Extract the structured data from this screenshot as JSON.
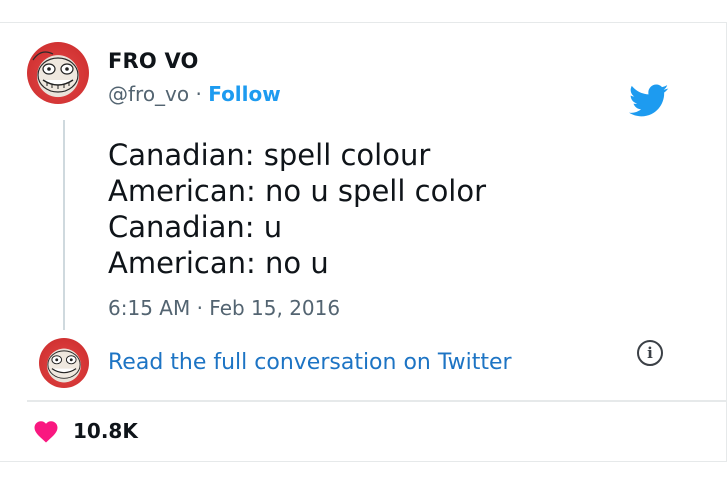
{
  "tweet": {
    "author_name": "FRO VO",
    "handle": "@fro_vo",
    "separator": "·",
    "follow_label": "Follow",
    "lines": [
      "Canadian: spell colour",
      "American: no u spell color",
      "Canadian: u",
      "American: no u"
    ],
    "timestamp": "6:15 AM · Feb 15, 2016",
    "read_full_label": "Read the full conversation on Twitter",
    "like_count": "10.8K"
  },
  "icons": {
    "brand": "twitter-bird-icon",
    "info": "info-icon",
    "like": "heart-icon"
  },
  "colors": {
    "link_blue": "#1d9bf0",
    "like_pink": "#f91880",
    "text": "#0f1419",
    "muted": "#536471"
  }
}
